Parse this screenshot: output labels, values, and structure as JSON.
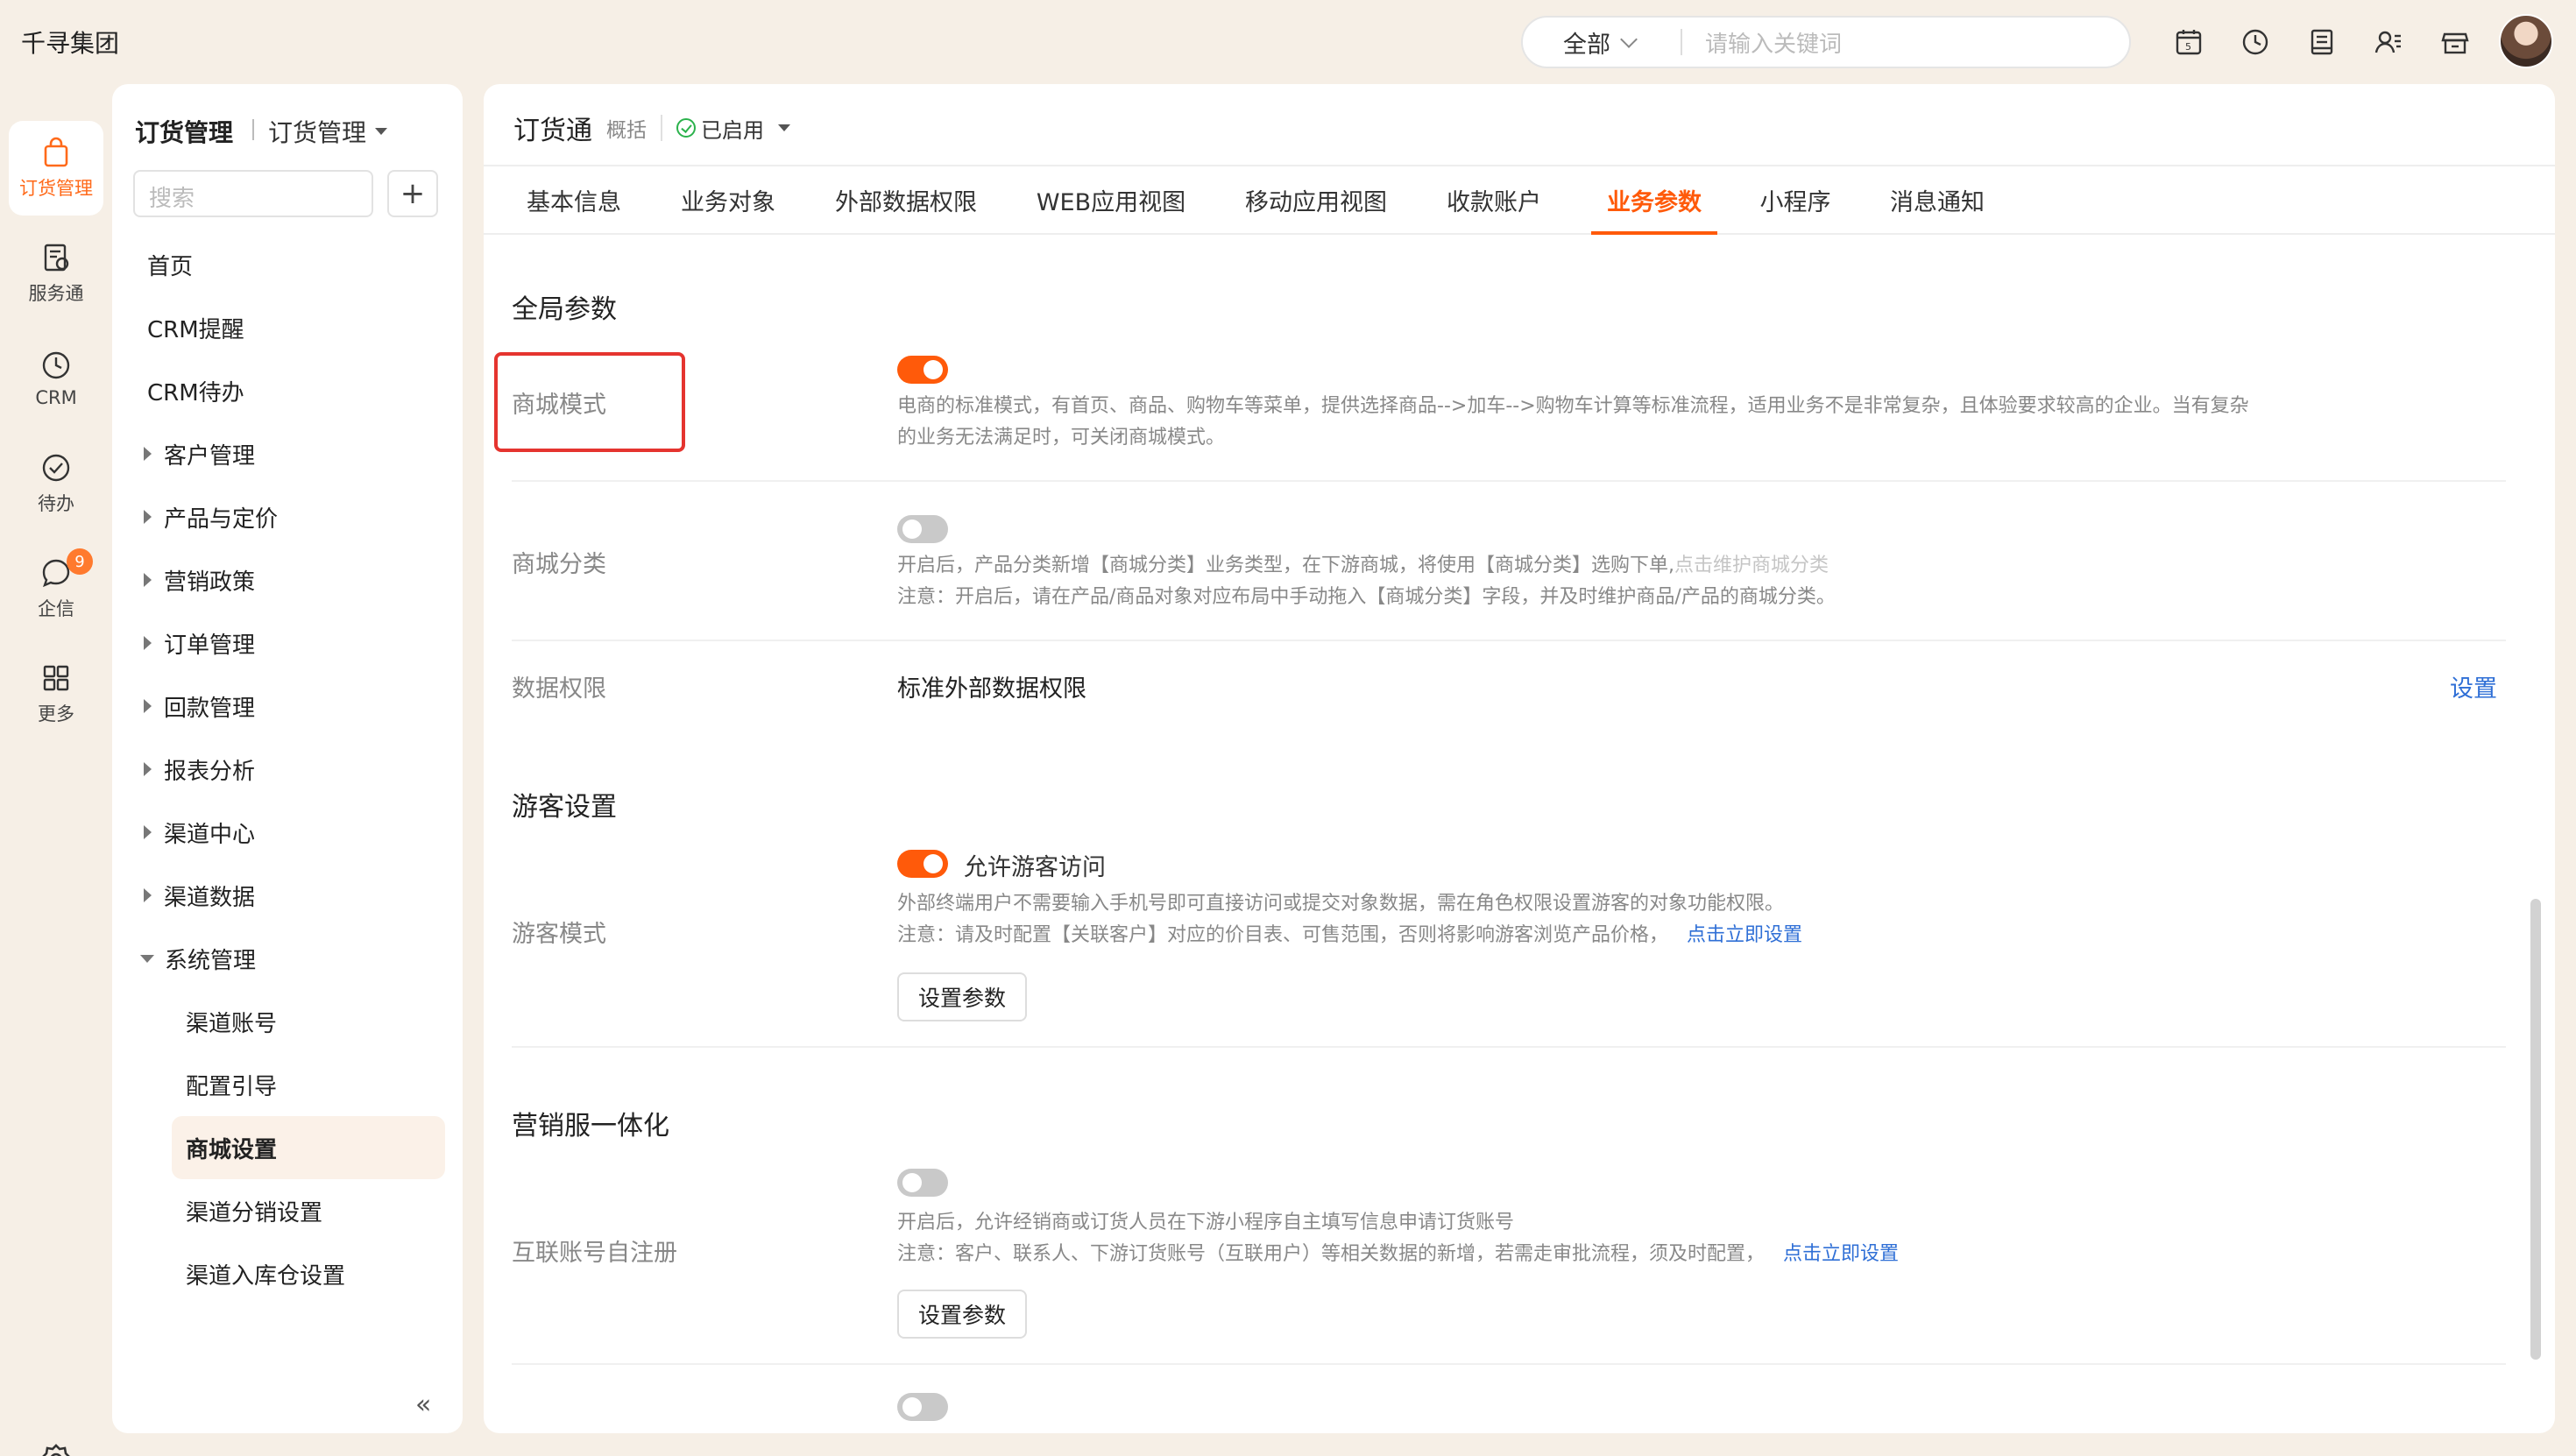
{
  "app": {
    "brand": "千寻集团"
  },
  "global_search": {
    "scope": "全部",
    "placeholder": "请输入关键词"
  },
  "top_icons": [
    "calendar-icon",
    "clock-icon",
    "notes-icon",
    "contacts-icon",
    "store-icon"
  ],
  "rail": {
    "items": [
      {
        "label": "订货管理",
        "icon": "bag-icon",
        "active": true
      },
      {
        "label": "服务通",
        "icon": "service-icon"
      },
      {
        "label": "CRM",
        "icon": "clock-icon"
      },
      {
        "label": "待办",
        "icon": "check-icon"
      },
      {
        "label": "企信",
        "icon": "chat-icon",
        "badge": "9"
      },
      {
        "label": "更多",
        "icon": "grid-icon"
      }
    ]
  },
  "sidenav": {
    "title": "订货管理",
    "subtitle": "订货管理",
    "search_placeholder": "搜索",
    "add_label": "+",
    "items": [
      {
        "label": "首页"
      },
      {
        "label": "CRM提醒"
      },
      {
        "label": "CRM待办"
      },
      {
        "label": "客户管理"
      },
      {
        "label": "产品与定价"
      },
      {
        "label": "营销政策"
      },
      {
        "label": "订单管理"
      },
      {
        "label": "回款管理"
      },
      {
        "label": "报表分析"
      },
      {
        "label": "渠道中心"
      },
      {
        "label": "渠道数据"
      },
      {
        "label": "系统管理"
      },
      {
        "label": "渠道账号"
      },
      {
        "label": "配置引导"
      },
      {
        "label": "商城设置"
      },
      {
        "label": "渠道分销设置"
      },
      {
        "label": "渠道入库仓设置"
      }
    ],
    "collapse_icon": "«"
  },
  "main": {
    "title": "订货通",
    "overview": "概括",
    "status": "已启用",
    "tabs": [
      {
        "label": "基本信息"
      },
      {
        "label": "业务对象"
      },
      {
        "label": "外部数据权限"
      },
      {
        "label": "WEB应用视图"
      },
      {
        "label": "移动应用视图"
      },
      {
        "label": "收款账户"
      },
      {
        "label": "业务参数",
        "active": true
      },
      {
        "label": "小程序"
      },
      {
        "label": "消息通知"
      }
    ],
    "global": {
      "title": "全局参数",
      "mall_mode": {
        "label": "商城模式",
        "enabled": true,
        "desc1": "电商的标准模式，有首页、商品、购物车等菜单，提供选择商品-->加车-->购物车计算等标准流程，适用业务不是非常复杂，且体验要求较高的企业。当有复杂",
        "desc2": "的业务无法满足时，可关闭商城模式。"
      },
      "mall_category": {
        "label": "商城分类",
        "enabled": false,
        "desc1": "开启后，产品分类新增【商城分类】业务类型，在下游商城，将使用【商城分类】选购下单,",
        "desc1_link": "点击维护商城分类",
        "desc2": "注意：开启后，请在产品/商品对象对应布局中手动拖入【商城分类】字段，并及时维护商品/产品的商城分类。"
      },
      "data_permission": {
        "label": "数据权限",
        "value": "标准外部数据权限",
        "action": "设置"
      }
    },
    "guest": {
      "title": "游客设置",
      "label": "游客模式",
      "enabled": true,
      "toggle_label": "允许游客访问",
      "desc1": "外部终端用户不需要输入手机号即可直接访问或提交对象数据，需在角色权限设置游客的对象功能权限。",
      "desc2": "注意：请及时配置【关联客户】对应的价目表、可售范围，否则将影响游客浏览产品价格，",
      "desc2_link": "点击立即设置",
      "button": "设置参数"
    },
    "marketing": {
      "title": "营销服一体化",
      "label": "互联账号自注册",
      "enabled": false,
      "desc1": "开启后，允许经销商或订货人员在下游小程序自主填写信息申请订货账号",
      "desc2": "注意：客户、联系人、下游订货账号（互联用户）等相关数据的新增，若需走审批流程，须及时配置，",
      "desc2_link": "点击立即设置",
      "button": "设置参数",
      "next_enabled": false
    }
  },
  "colors": {
    "accent": "#ff5a0a",
    "link": "#2f6fd6",
    "highlight": "#e5342f"
  }
}
